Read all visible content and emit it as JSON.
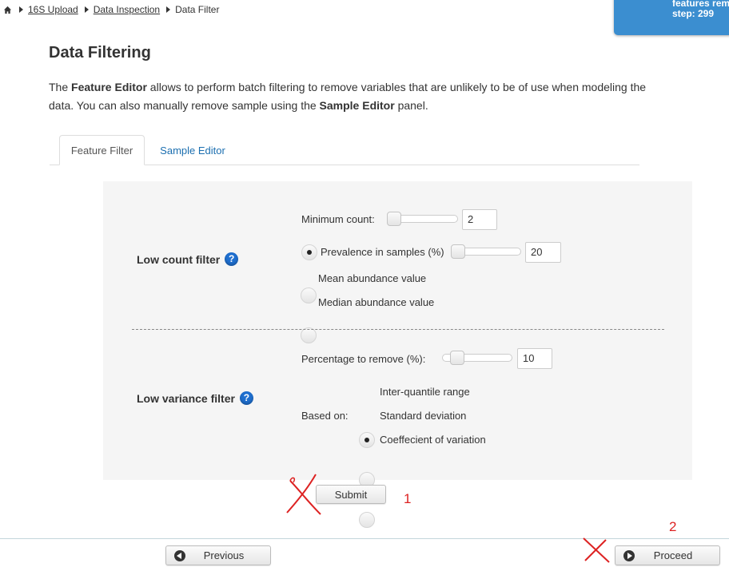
{
  "breadcrumb": {
    "home_icon": "home-icon",
    "items": [
      "16S Upload",
      "Data Inspection"
    ],
    "current": "Data Filter"
  },
  "status": {
    "line1": "features rem",
    "line2": "step: 299",
    "color": "#3b8ed0"
  },
  "page": {
    "title": "Data Filtering",
    "desc_part1": "The ",
    "desc_bold1": "Feature Editor",
    "desc_part2": " allows to perform batch filtering to remove variables that are unlikely to be of use when modeling the data. You can also manually remove sample using the ",
    "desc_bold2": "Sample Editor",
    "desc_part3": " panel."
  },
  "tabs": {
    "active": "Feature Filter",
    "other": "Sample Editor"
  },
  "low_count": {
    "label": "Low count filter",
    "min_count_label": "Minimum count:",
    "min_count_value": "2",
    "prevalence_label": "Prevalence in samples (%)",
    "prevalence_value": "20",
    "mean_label": "Mean abundance value",
    "median_label": "Median abundance value",
    "selected": "Prevalence in samples (%)"
  },
  "low_variance": {
    "label": "Low variance filter",
    "percent_label": "Percentage to remove (%):",
    "percent_value": "10",
    "based_on_label": "Based on:",
    "iqr_label": "Inter-quantile range",
    "sd_label": "Standard deviation",
    "cv_label": "Coeffecient of variation",
    "selected": "Inter-quantile range"
  },
  "buttons": {
    "submit": "Submit",
    "previous": "Previous",
    "proceed": "Proceed"
  },
  "annotations": {
    "mark1": "1",
    "mark2": "2",
    "color": "#dd2222"
  }
}
